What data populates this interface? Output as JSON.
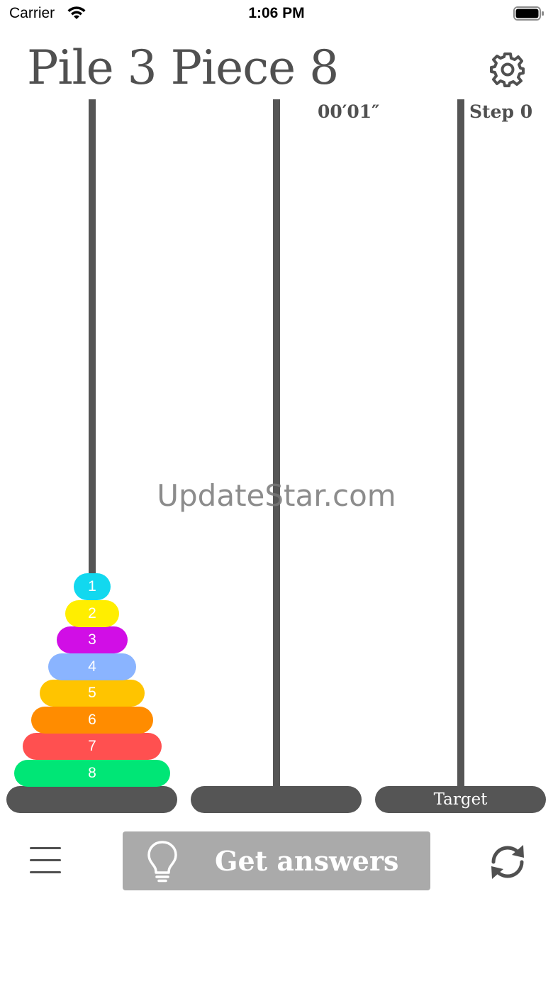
{
  "status_bar": {
    "carrier": "Carrier",
    "time": "1:06 PM"
  },
  "header": {
    "title": "Pile 3 Piece 8",
    "timer": "00′01″",
    "steps": "Step 0"
  },
  "piles": [
    {
      "label": "",
      "disks": [
        1,
        2,
        3,
        4,
        5,
        6,
        7,
        8
      ]
    },
    {
      "label": "",
      "disks": []
    },
    {
      "label": "Target",
      "disks": []
    }
  ],
  "disks": [
    {
      "label": "1",
      "color": "#12d8ef"
    },
    {
      "label": "2",
      "color": "#ffee00"
    },
    {
      "label": "3",
      "color": "#d10ee6"
    },
    {
      "label": "4",
      "color": "#8ab4ff"
    },
    {
      "label": "5",
      "color": "#ffc400"
    },
    {
      "label": "6",
      "color": "#ff8c00"
    },
    {
      "label": "7",
      "color": "#ff5050"
    },
    {
      "label": "8",
      "color": "#00e676"
    }
  ],
  "watermark": "UpdateStar.com",
  "toolbar": {
    "answers_label": "Get answers"
  },
  "colors": {
    "rod": "#555555",
    "button": "#aaaaaa",
    "text": "#505050"
  }
}
